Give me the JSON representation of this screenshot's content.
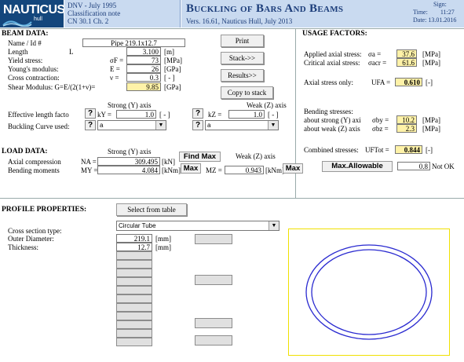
{
  "header": {
    "logo_text": "NAUTICUS",
    "logo_sub": "hull",
    "info_line1": "DNV - July 1995",
    "info_line2": "Classification note",
    "info_line3": "CN 30.1  Ch. 2",
    "title": "Buckling of Bars And Beams",
    "version": "Vers. 16.61, Nauticus Hull, July 2013",
    "sign_label": "Sign:",
    "time_label": "Time:",
    "time_value": "11:27",
    "date_label": "Date:",
    "date_value": "13.01.2016"
  },
  "beam": {
    "section": "BEAM DATA:",
    "name_label": "Name  /  Id #",
    "name_value": "Pipe 219.1x12.7",
    "length_label": "Length",
    "length_sym": "L",
    "length_value": "3.100",
    "length_unit": "[m]",
    "yield_label": "Yield stress:",
    "yield_sym": "σF =",
    "yield_value": "73",
    "yield_unit": "[MPa]",
    "young_label": "Young's modulus:",
    "young_sym": "E =",
    "young_value": "26",
    "young_unit": "[GPa]",
    "cross_label": "Cross contraction:",
    "cross_sym": "ν =",
    "cross_value": "0.3",
    "cross_unit": "[ - ]",
    "shear_label": "Shear Modulus: G=E/(2(1+ν)=",
    "shear_value": "9.85",
    "shear_unit": "[GPa]",
    "strong_axis": "Strong (Y) axis",
    "weak_axis": "Weak (Z) axis",
    "efflen_label": "Effective length facto",
    "ky_sym": "kY =",
    "ky_value": "1.0",
    "kz_sym": "kZ =",
    "kz_value": "1.0",
    "nondim": "[ - ]",
    "curve_label": "Buckling Curve used:",
    "curve_y": "a",
    "curve_z": "a",
    "q": "?"
  },
  "buttons": {
    "print": "Print",
    "stack": "Stack->>",
    "results": "Results>>",
    "copy": "Copy to stack",
    "find_max": "Find Max",
    "max1": "Max",
    "max2": "Max",
    "max_allowable": "Max.Allowable",
    "select_table": "Select from table"
  },
  "usage": {
    "section": "USAGE FACTORS:",
    "applied_label": "Applied axial stress:",
    "applied_sym": "σa =",
    "applied_value": "37.6",
    "critical_label": "Critical axial stress:",
    "critical_sym": "σacr =",
    "critical_value": "61.6",
    "unit_mpa": "[MPa]",
    "axial_only_label": "Axial stress only:",
    "ufa_sym": "UFA =",
    "ufa_value": "0.610",
    "dash": "[-]",
    "bending_label": "Bending stresses:",
    "about_strong": "about strong (Y) axi",
    "sby_sym": "σby =",
    "sby_value": "10.2",
    "about_weak": "about weak (Z) axis",
    "sbz_sym": "σbz =",
    "sbz_value": "2.3",
    "combined_label": "Combined stresses:",
    "uftot_sym": "UFTot =",
    "uftot_value": "0.844",
    "allow_value": "0.8",
    "status": "Not OK"
  },
  "load": {
    "section": "LOAD DATA:",
    "strong_axis": "Strong (Y) axis",
    "weak_axis": "Weak (Z) axis",
    "axial_label": "Axial compression",
    "na_sym": "NA =",
    "na_value": "309.495",
    "na_unit": "[kN]",
    "bending_label": "Bending moments",
    "my_sym": "MY =",
    "my_value": "4.084",
    "my_unit": "[kNm]",
    "mz_sym": "MZ =",
    "mz_value": "0.943",
    "mz_unit": "[kNm]"
  },
  "profile": {
    "section": "PROFILE PROPERTIES:",
    "type_label": "Cross section type:",
    "type_value": "Circular Tube",
    "od_label": "Outer Diameter:",
    "od_value": "219.1",
    "od_unit": "[mm]",
    "t_label": "Thickness:",
    "t_value": "12.7",
    "t_unit": "[mm]"
  },
  "colors": {
    "header_bg": "#c9daf0",
    "logo_bg": "#13467c",
    "input_yellow": "#fff2a8",
    "preview_border": "#f0e000",
    "ring": "#2a2ad0"
  }
}
